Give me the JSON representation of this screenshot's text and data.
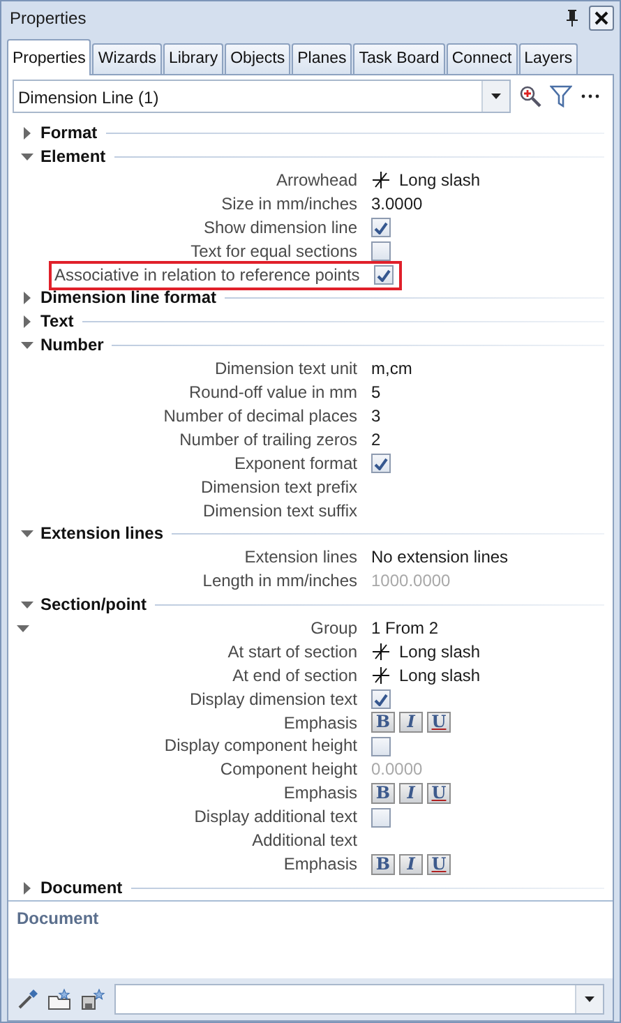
{
  "window": {
    "title": "Properties"
  },
  "tabs": [
    {
      "label": "Properties",
      "selected": true
    },
    {
      "label": "Wizards",
      "selected": false
    },
    {
      "label": "Library",
      "selected": false
    },
    {
      "label": "Objects",
      "selected": false
    },
    {
      "label": "Planes",
      "selected": false
    },
    {
      "label": "Task Board",
      "selected": false
    },
    {
      "label": "Connect",
      "selected": false
    },
    {
      "label": "Layers",
      "selected": false
    }
  ],
  "selector": {
    "value": "Dimension Line (1)"
  },
  "sections": [
    {
      "title": "Format",
      "expanded": false
    },
    {
      "title": "Element",
      "expanded": true,
      "rows": [
        {
          "label": "Arrowhead",
          "kind": "symbol",
          "value": "Long slash"
        },
        {
          "label": "Size in mm/inches",
          "kind": "text",
          "value": "3.0000"
        },
        {
          "label": "Show dimension line",
          "kind": "check",
          "checked": true
        },
        {
          "label": "Text for equal sections",
          "kind": "check",
          "checked": false
        },
        {
          "label": "Associative in relation to reference points",
          "kind": "check",
          "checked": true,
          "highlighted": true
        }
      ]
    },
    {
      "title": "Dimension line format",
      "expanded": false
    },
    {
      "title": "Text",
      "expanded": false
    },
    {
      "title": "Number",
      "expanded": true,
      "rows": [
        {
          "label": "Dimension text unit",
          "kind": "text",
          "value": "m,cm"
        },
        {
          "label": "Round-off value in mm",
          "kind": "text",
          "value": "5"
        },
        {
          "label": "Number of decimal places",
          "kind": "text",
          "value": "3"
        },
        {
          "label": "Number of trailing zeros",
          "kind": "text",
          "value": "2"
        },
        {
          "label": "Exponent format",
          "kind": "check",
          "checked": true
        },
        {
          "label": "Dimension text prefix",
          "kind": "empty"
        },
        {
          "label": "Dimension text suffix",
          "kind": "empty"
        }
      ]
    },
    {
      "title": "Extension lines",
      "expanded": true,
      "rows": [
        {
          "label": "Extension lines",
          "kind": "text",
          "value": "No extension lines"
        },
        {
          "label": "Length in mm/inches",
          "kind": "text",
          "value": "1000.0000",
          "disabled": true
        }
      ]
    },
    {
      "title": "Section/point",
      "expanded": true,
      "rows": [
        {
          "label": "Group",
          "kind": "text",
          "value": "1 From 2",
          "expanded": true
        },
        {
          "label": "At start of section",
          "kind": "symbol",
          "value": "Long slash"
        },
        {
          "label": "At end of section",
          "kind": "symbol",
          "value": "Long slash"
        },
        {
          "label": "Display dimension text",
          "kind": "check",
          "checked": true
        },
        {
          "label": "Emphasis",
          "kind": "emphasis",
          "buttons": [
            "B",
            "I",
            "U"
          ]
        },
        {
          "label": "Display component height",
          "kind": "check",
          "checked": false
        },
        {
          "label": "Component height",
          "kind": "text",
          "value": "0.0000",
          "disabled": true
        },
        {
          "label": "Emphasis",
          "kind": "emphasis",
          "buttons": [
            "B",
            "I",
            "U"
          ]
        },
        {
          "label": "Display additional text",
          "kind": "check",
          "checked": false
        },
        {
          "label": "Additional text",
          "kind": "empty"
        },
        {
          "label": "Emphasis",
          "kind": "emphasis",
          "buttons": [
            "B",
            "I",
            "U"
          ]
        }
      ]
    },
    {
      "title": "Document",
      "expanded": false
    }
  ],
  "description": {
    "title": "Document"
  }
}
